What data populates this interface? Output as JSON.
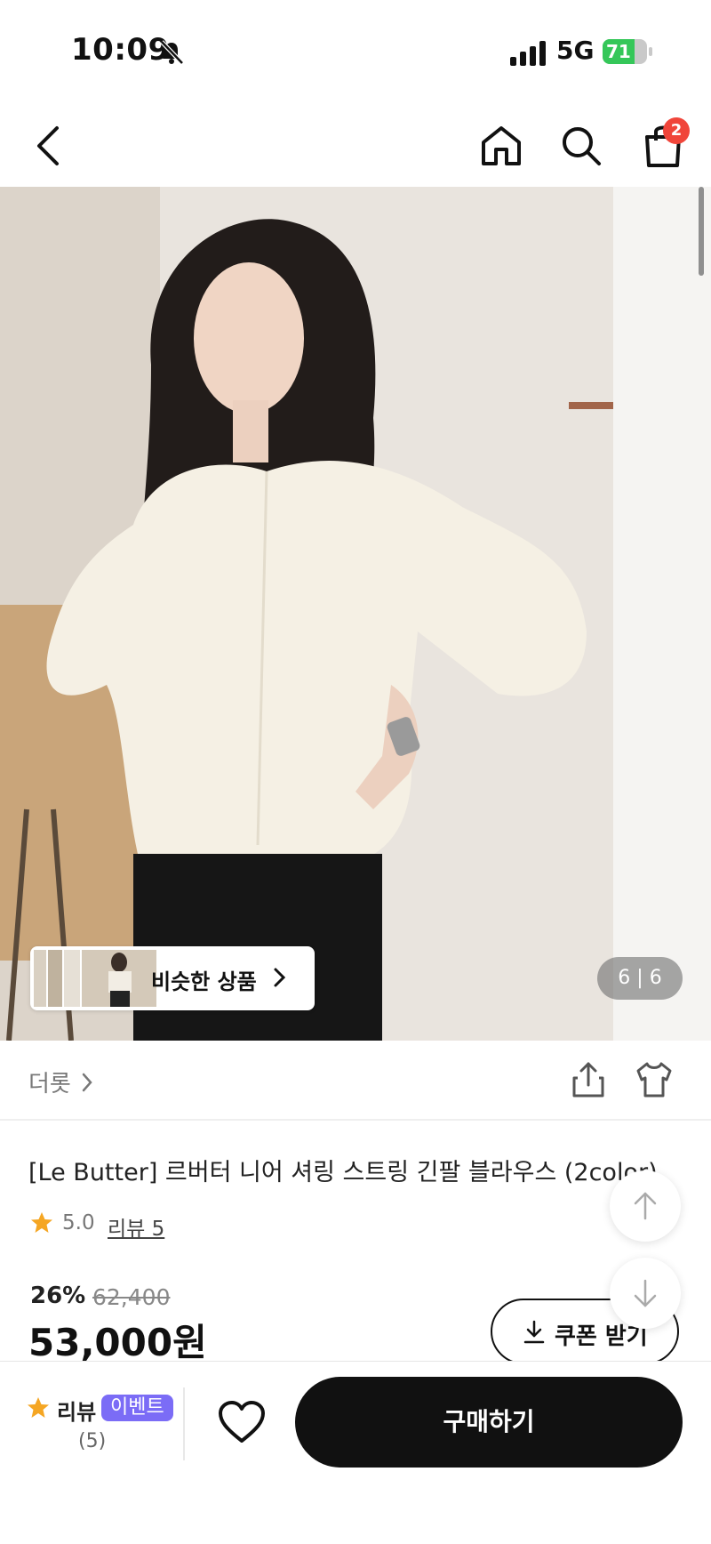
{
  "status_bar": {
    "time": "10:09",
    "network": "5G",
    "battery": "71",
    "battery_level": 0.71
  },
  "nav": {
    "cart_count": "2"
  },
  "gallery": {
    "similar_label": "비슷한 상품",
    "pager": "6 | 6"
  },
  "product": {
    "brand": "더롯",
    "title": "[Le Butter] 르버터 니어 셔링 스트링 긴팔 블라우스 (2color)",
    "rating": "5.0",
    "review_link": "리뷰 5",
    "discount": "26%",
    "original_price": "62,400",
    "price": "53,000원",
    "coupon_label": "쿠폰 받기"
  },
  "bottom_bar": {
    "review_label": "리뷰",
    "event_badge": "이벤트",
    "review_count": "(5)",
    "buy_label": "구매하기"
  },
  "colors": {
    "accent_star": "#f5a623",
    "event_badge": "#7b6cf6",
    "cart_badge": "#f0453a",
    "buy_button": "#111111"
  },
  "icons": [
    "bell-slash-icon",
    "signal-icon",
    "battery-icon",
    "back-icon",
    "home-icon",
    "search-icon",
    "shopping-bag-icon",
    "chevron-right-icon",
    "share-icon",
    "outfit-icon",
    "star-icon",
    "download-icon",
    "arrow-up-icon",
    "arrow-down-icon",
    "heart-icon"
  ]
}
